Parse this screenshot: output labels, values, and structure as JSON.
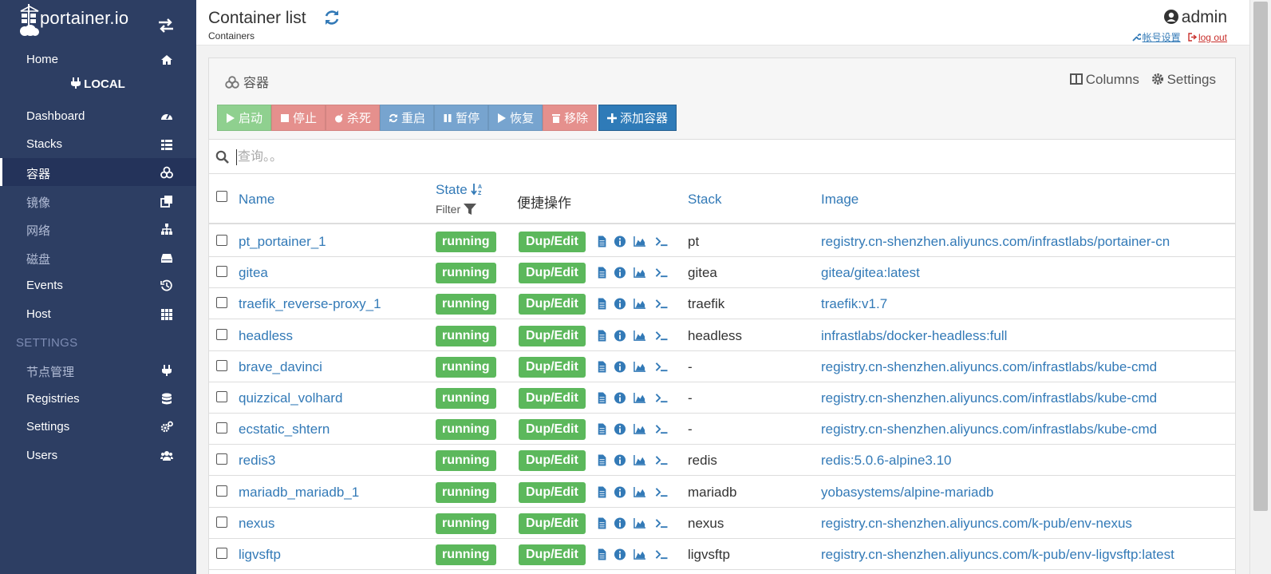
{
  "sidebar": {
    "brand": "portainer.io",
    "home": "Home",
    "endpoint": "LOCAL",
    "items": [
      {
        "label": "Dashboard",
        "icon": "tachometer-icon"
      },
      {
        "label": "Stacks",
        "icon": "th-list-icon"
      },
      {
        "label": "容器",
        "icon": "cubes-icon"
      },
      {
        "label": "镜像",
        "icon": "clone-icon"
      },
      {
        "label": "网络",
        "icon": "sitemap-icon"
      },
      {
        "label": "磁盘",
        "icon": "hdd-icon"
      },
      {
        "label": "Events",
        "icon": "history-icon"
      },
      {
        "label": "Host",
        "icon": "th-icon"
      }
    ],
    "settings_title": "SETTINGS",
    "settings_items": [
      {
        "label": "节点管理",
        "icon": "plug-icon"
      },
      {
        "label": "Registries",
        "icon": "database-icon"
      },
      {
        "label": "Settings",
        "icon": "cogs-icon"
      },
      {
        "label": "Users",
        "icon": "users-icon"
      }
    ]
  },
  "header": {
    "title": "Container list",
    "breadcrumb": "Containers",
    "user": "admin",
    "account_settings": "帐号设置",
    "logout": "log out"
  },
  "panel": {
    "title": "容器",
    "columns": "Columns",
    "settings": "Settings",
    "toolbar": {
      "start": "启动",
      "stop": "停止",
      "kill": "杀死",
      "restart": "重启",
      "pause": "暂停",
      "resume": "恢复",
      "remove": "移除",
      "add": "添加容器"
    },
    "search_placeholder": "查询。。"
  },
  "table": {
    "headers": {
      "name": "Name",
      "state": "State",
      "state_filter": "Filter",
      "quick_actions": "便捷操作",
      "stack": "Stack",
      "image": "Image"
    },
    "dup_label": "Dup/Edit",
    "rows": [
      {
        "name": "pt_portainer_1",
        "state": "running",
        "stack": "pt",
        "image": "registry.cn-shenzhen.aliyuncs.com/infrastlabs/portainer-cn"
      },
      {
        "name": "gitea",
        "state": "running",
        "stack": "gitea",
        "image": "gitea/gitea:latest"
      },
      {
        "name": "traefik_reverse-proxy_1",
        "state": "running",
        "stack": "traefik",
        "image": "traefik:v1.7"
      },
      {
        "name": "headless",
        "state": "running",
        "stack": "headless",
        "image": "infrastlabs/docker-headless:full"
      },
      {
        "name": "brave_davinci",
        "state": "running",
        "stack": "-",
        "image": "registry.cn-shenzhen.aliyuncs.com/infrastlabs/kube-cmd"
      },
      {
        "name": "quizzical_volhard",
        "state": "running",
        "stack": "-",
        "image": "registry.cn-shenzhen.aliyuncs.com/infrastlabs/kube-cmd"
      },
      {
        "name": "ecstatic_shtern",
        "state": "running",
        "stack": "-",
        "image": "registry.cn-shenzhen.aliyuncs.com/infrastlabs/kube-cmd"
      },
      {
        "name": "redis3",
        "state": "running",
        "stack": "redis",
        "image": "redis:5.0.6-alpine3.10"
      },
      {
        "name": "mariadb_mariadb_1",
        "state": "running",
        "stack": "mariadb",
        "image": "yobasystems/alpine-mariadb"
      },
      {
        "name": "nexus",
        "state": "running",
        "stack": "nexus",
        "image": "registry.cn-shenzhen.aliyuncs.com/k-pub/env-nexus"
      },
      {
        "name": "ligvsftp",
        "state": "running",
        "stack": "ligvsftp",
        "image": "registry.cn-shenzhen.aliyuncs.com/k-pub/env-ligvsftp:latest"
      }
    ]
  },
  "colors": {
    "sidebar_bg": "#2d3e63",
    "link": "#337ab7",
    "success": "#5cb85c"
  }
}
